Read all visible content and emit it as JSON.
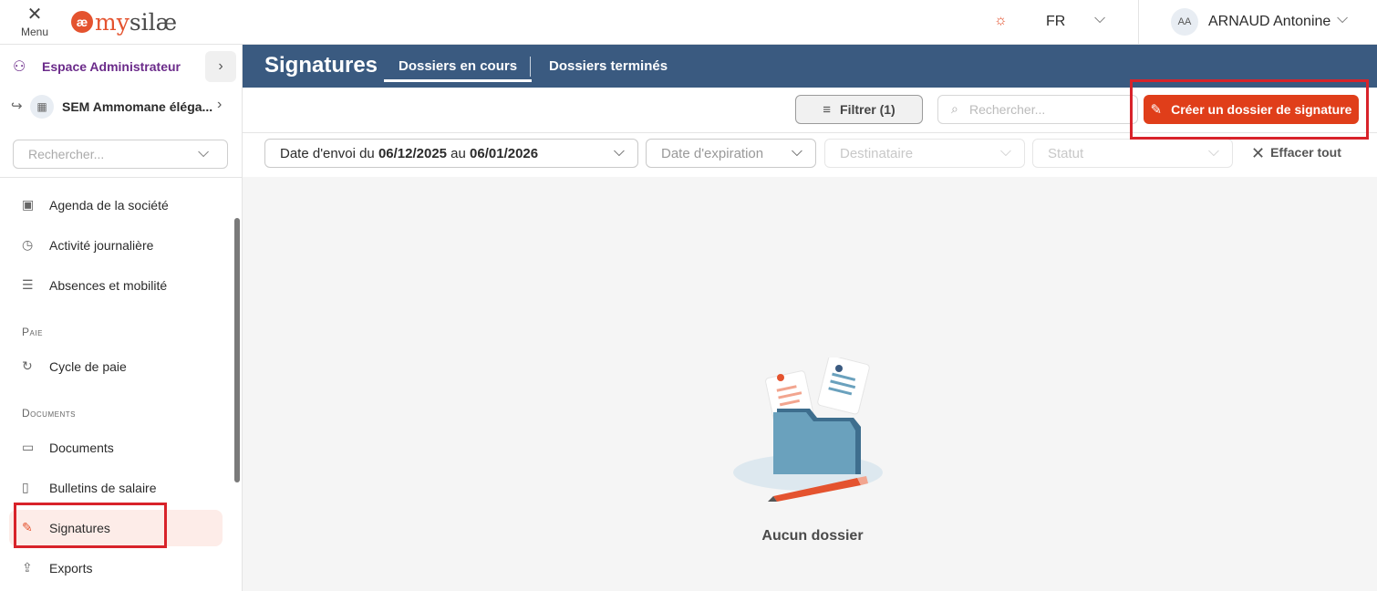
{
  "topbar": {
    "menu_icon": "close-icon",
    "menu_label": "Menu",
    "logo_mark": "æ",
    "logo_text_a": "my",
    "logo_text_b": "silæ",
    "theme_icon": "sun-icon",
    "language": "FR",
    "user_initials": "AA",
    "user_name": "ARNAUD Antonine"
  },
  "sidebar": {
    "admin_label": "Espace Administrateur",
    "company_name": "SEM Ammomane éléga...",
    "search_placeholder": "Rechercher...",
    "items": [
      {
        "label": "Agenda de la société",
        "icon": "calendar-icon"
      },
      {
        "label": "Activité journalière",
        "icon": "clock-icon"
      },
      {
        "label": "Absences et mobilité",
        "icon": "list-icon"
      },
      {
        "label": "Cycle de paie",
        "icon": "payroll-cycle-icon"
      },
      {
        "label": "Documents",
        "icon": "folder-icon"
      },
      {
        "label": "Bulletins de salaire",
        "icon": "payslip-icon"
      },
      {
        "label": "Signatures",
        "icon": "pen-icon",
        "active": true
      },
      {
        "label": "Exports",
        "icon": "export-icon"
      }
    ],
    "sections": {
      "paie": "Paie",
      "documents": "Documents"
    }
  },
  "content": {
    "title": "Signatures",
    "tabs": [
      {
        "label": "Dossiers en cours",
        "active": true
      },
      {
        "label": "Dossiers terminés",
        "active": false
      }
    ],
    "filter_button": "Filtrer (1)",
    "search_placeholder": "Rechercher...",
    "create_button": "Créer un dossier de signature",
    "filters": {
      "send_date_prefix": "Date d'envoi du ",
      "send_date_from": "06/12/2025",
      "send_date_mid": " au ",
      "send_date_to": "06/01/2026",
      "expiration": "Date d'expiration",
      "recipient": "Destinataire",
      "status": "Statut",
      "clear_all": "Effacer tout"
    },
    "empty_text": "Aucun dossier"
  },
  "colors": {
    "brand": "#e4532f",
    "header": "#3a5a80",
    "admin": "#6b2b8a",
    "highlight": "#d8232a"
  }
}
